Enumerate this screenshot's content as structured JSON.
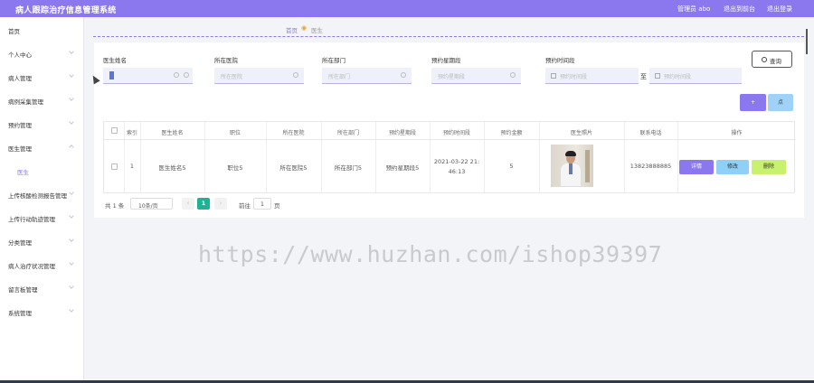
{
  "app": {
    "title": "病人跟踪治疗信息管理系统"
  },
  "topbar": {
    "admin": "管理员 abo",
    "exit_front": "退出到前台",
    "logout": "退出登录"
  },
  "sidebar": {
    "items": [
      {
        "label": "首页"
      },
      {
        "label": "个人中心"
      },
      {
        "label": "病人管理"
      },
      {
        "label": "病例采集管理"
      },
      {
        "label": "预约管理"
      },
      {
        "label": "医生管理"
      },
      {
        "label": "医生"
      },
      {
        "label": "上传核酸检测报告管理"
      },
      {
        "label": "上传行动轨迹管理"
      },
      {
        "label": "分类管理"
      },
      {
        "label": "病人治疗状况管理"
      },
      {
        "label": "留言板管理"
      },
      {
        "label": "系统管理"
      }
    ]
  },
  "breadcrumb": {
    "home": "首页",
    "current": "医生"
  },
  "filters": {
    "doctor_name": {
      "label": "医生姓名",
      "value": ""
    },
    "hospital": {
      "label": "所在医院",
      "placeholder": "所在医院"
    },
    "department": {
      "label": "所在部门",
      "placeholder": "所在部门"
    },
    "weekday": {
      "label": "预约星期段",
      "placeholder": "预约星期段"
    },
    "time": {
      "label": "预约时间段",
      "start_placeholder": "预约时间段",
      "separator": "至",
      "end_placeholder": "预约时间段"
    }
  },
  "buttons": {
    "query": "查询",
    "add": "+",
    "delete": "点"
  },
  "table": {
    "columns": [
      "索引",
      "医生姓名",
      "职位",
      "所在医院",
      "所在部门",
      "预约星期段",
      "预约时间段",
      "预约金额",
      "医生照片",
      "联系电话",
      "操作"
    ],
    "rows": [
      {
        "index": "1",
        "doctor_name": "医生姓名5",
        "position": "职位5",
        "hospital": "所在医院5",
        "department": "所在部门5",
        "weekday": "预约星期段5",
        "time_line1": "2021-03-22 21:",
        "time_line2": "46:13",
        "amount": "5",
        "phone": "13823888885",
        "actions": {
          "detail": "详情",
          "edit": "修改",
          "delete": "删除"
        }
      }
    ]
  },
  "pagination": {
    "total": "共 1 条",
    "page_size": "10条/页",
    "current_page": "1",
    "goto_label": "前往",
    "goto_value": "1",
    "page_unit": "页"
  },
  "watermark": "https://www.huzhan.com/ishop39397",
  "colors": {
    "accent": "#8b78ee",
    "info": "#8fd0f6",
    "success": "#c8f26d",
    "page_active": "#1bb394"
  }
}
